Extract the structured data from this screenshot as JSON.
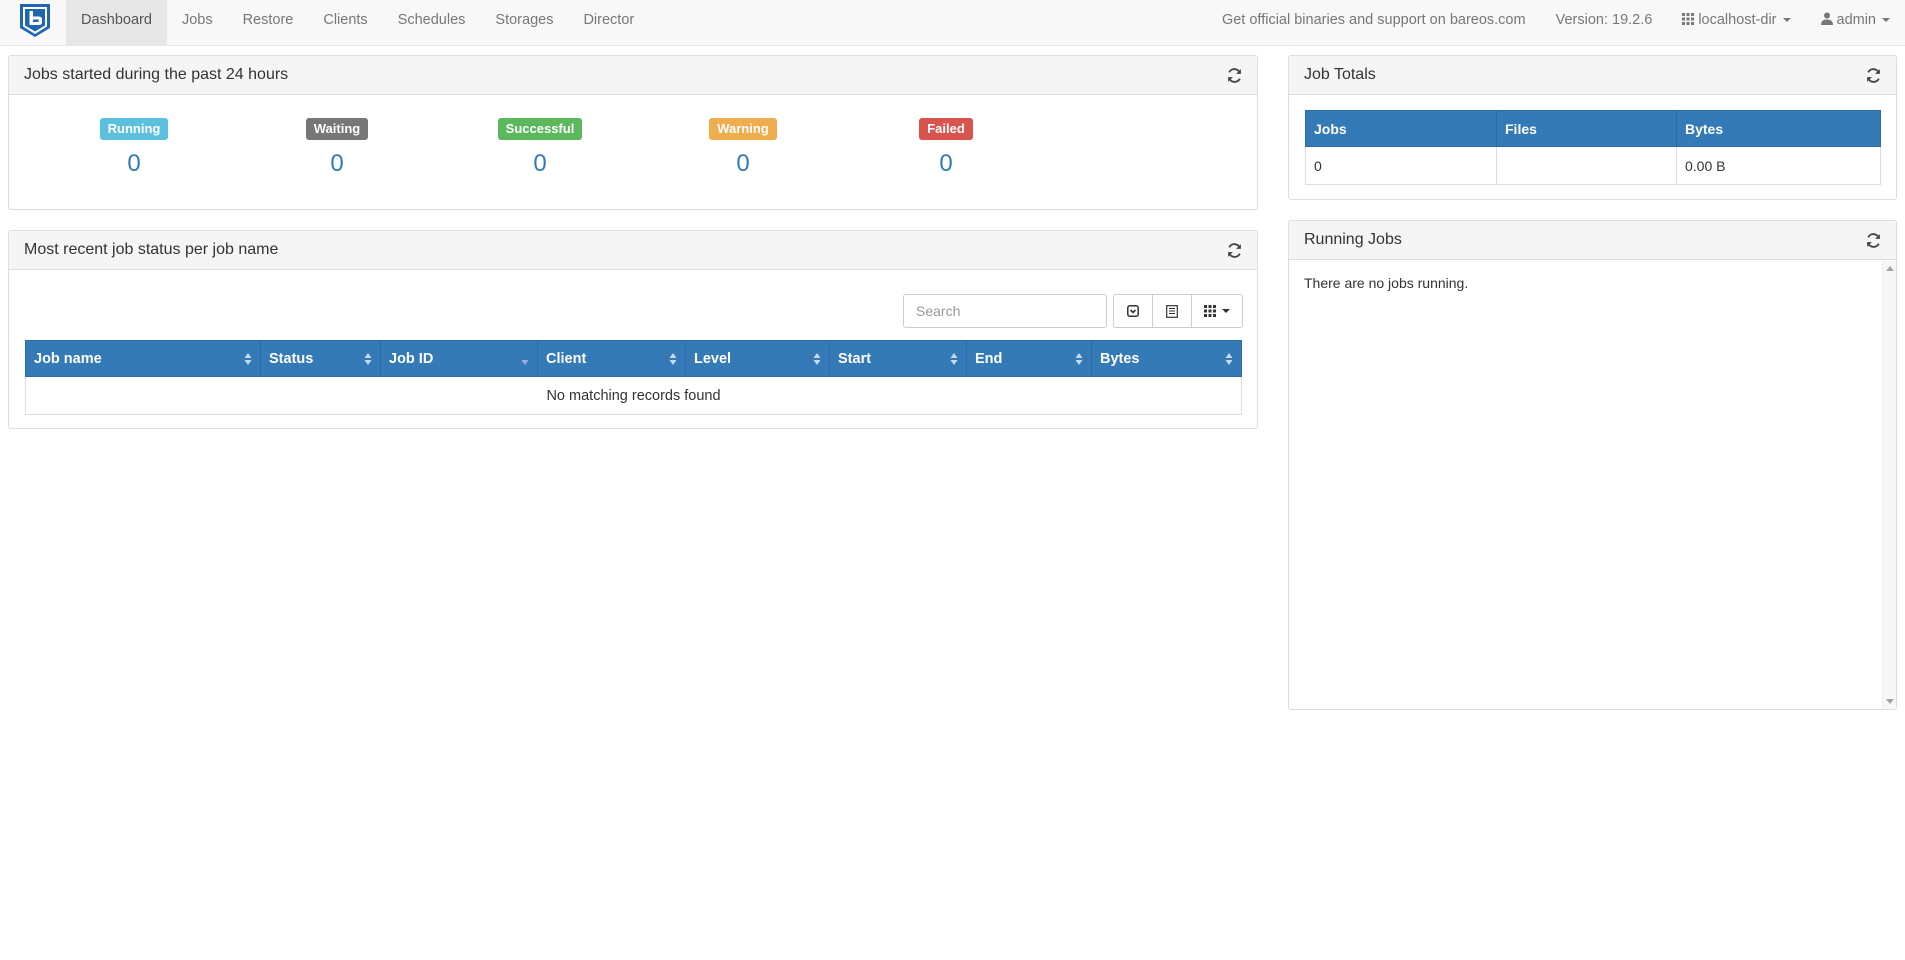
{
  "nav": {
    "items": [
      {
        "label": "Dashboard",
        "active": true
      },
      {
        "label": "Jobs"
      },
      {
        "label": "Restore"
      },
      {
        "label": "Clients"
      },
      {
        "label": "Schedules"
      },
      {
        "label": "Storages"
      },
      {
        "label": "Director"
      }
    ],
    "support_text": "Get official binaries and support on bareos.com",
    "version": "Version: 19.2.6",
    "director": "localhost-dir",
    "user": "admin"
  },
  "jobs24h": {
    "title": "Jobs started during the past 24 hours",
    "statuses": [
      {
        "label": "Running",
        "count": "0",
        "color": "#5bc0de"
      },
      {
        "label": "Waiting",
        "count": "0",
        "color": "#777777"
      },
      {
        "label": "Successful",
        "count": "0",
        "color": "#5cb85c"
      },
      {
        "label": "Warning",
        "count": "0",
        "color": "#f0ad4e"
      },
      {
        "label": "Failed",
        "count": "0",
        "color": "#d9534f"
      }
    ]
  },
  "recent": {
    "title": "Most recent job status per job name",
    "search_placeholder": "Search",
    "columns": [
      "Job name",
      "Status",
      "Job ID",
      "Client",
      "Level",
      "Start",
      "End",
      "Bytes"
    ],
    "empty": "No matching records found"
  },
  "totals": {
    "title": "Job Totals",
    "columns": [
      "Jobs",
      "Files",
      "Bytes"
    ],
    "row": [
      "0",
      "",
      "0.00 B"
    ]
  },
  "running": {
    "title": "Running Jobs",
    "message": "There are no jobs running."
  },
  "colors": {
    "primary": "#337ab7",
    "navbar_bg": "#f8f8f8",
    "logo": "#1e66b2"
  }
}
